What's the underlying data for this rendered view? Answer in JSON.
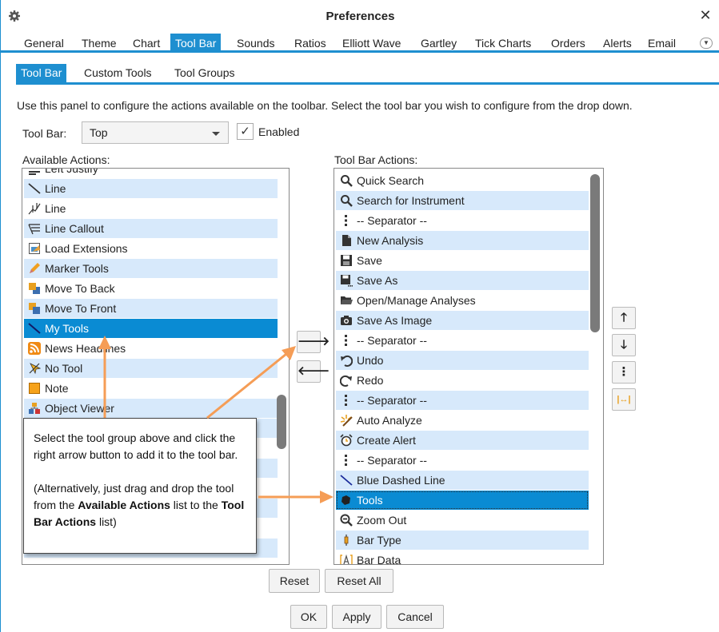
{
  "window": {
    "title": "Preferences",
    "close_symbol": "✕"
  },
  "tabs": [
    "General",
    "Theme",
    "Chart",
    "Tool Bar",
    "Sounds",
    "Ratios",
    "Elliott Wave",
    "Gartley",
    "Tick Charts",
    "Orders",
    "Alerts",
    "Email"
  ],
  "active_tab": "Tool Bar",
  "subtabs": [
    "Tool Bar",
    "Custom Tools",
    "Tool Groups"
  ],
  "active_subtab": "Tool Bar",
  "description": "Use this panel to configure the actions available on the toolbar.  Select the tool bar you wish to configure from the drop down.",
  "toolbar_select": {
    "label": "Tool Bar:",
    "value": "Top"
  },
  "enabled": {
    "label": "Enabled",
    "checked": true,
    "check_symbol": "✓"
  },
  "available": {
    "label": "Available Actions:",
    "items": [
      {
        "label": "Left Justify",
        "icon": "left-justify-icon"
      },
      {
        "label": "Line",
        "icon": "line-icon"
      },
      {
        "label": "Line",
        "icon": "line-tool-icon"
      },
      {
        "label": "Line Callout",
        "icon": "line-callout-icon"
      },
      {
        "label": "Load Extensions",
        "icon": "load-extensions-icon"
      },
      {
        "label": "Marker Tools",
        "icon": "marker-icon"
      },
      {
        "label": "Move To Back",
        "icon": "move-to-back-icon"
      },
      {
        "label": "Move To Front",
        "icon": "move-to-front-icon"
      },
      {
        "label": "My Tools",
        "icon": "my-tools-icon"
      },
      {
        "label": "News Headlines",
        "icon": "rss-icon"
      },
      {
        "label": "No Tool",
        "icon": "no-tool-icon"
      },
      {
        "label": "Note",
        "icon": "note-icon"
      },
      {
        "label": "Object Viewer",
        "icon": "object-viewer-icon"
      }
    ],
    "selected": "My Tools"
  },
  "toolbar_actions": {
    "label": "Tool Bar Actions:",
    "items": [
      {
        "label": "Quick Search",
        "icon": "search-icon"
      },
      {
        "label": "Search for Instrument",
        "icon": "search-icon"
      },
      {
        "label": "-- Separator --",
        "icon": "separator-icon"
      },
      {
        "label": "New Analysis",
        "icon": "document-icon"
      },
      {
        "label": "Save",
        "icon": "save-icon"
      },
      {
        "label": "Save As",
        "icon": "save-as-icon"
      },
      {
        "label": "Open/Manage Analyses",
        "icon": "folder-icon"
      },
      {
        "label": "Save As Image",
        "icon": "camera-icon"
      },
      {
        "label": "-- Separator --",
        "icon": "separator-icon"
      },
      {
        "label": "Undo",
        "icon": "undo-icon"
      },
      {
        "label": "Redo",
        "icon": "redo-icon"
      },
      {
        "label": "-- Separator --",
        "icon": "separator-icon"
      },
      {
        "label": "Auto Analyze",
        "icon": "auto-analyze-icon"
      },
      {
        "label": "Create Alert",
        "icon": "alarm-icon"
      },
      {
        "label": "-- Separator --",
        "icon": "separator-icon"
      },
      {
        "label": "Blue Dashed Line",
        "icon": "line-icon"
      },
      {
        "label": "Tools",
        "icon": "tools-icon"
      },
      {
        "label": "Zoom Out",
        "icon": "zoom-out-icon"
      },
      {
        "label": "Bar Type",
        "icon": "bar-type-icon"
      },
      {
        "label": "Bar Data",
        "icon": "bar-data-icon"
      }
    ],
    "selected": "Tools"
  },
  "move_buttons": {
    "add": "🡒",
    "remove": "🡐"
  },
  "order_buttons": {
    "up": "🡑",
    "down": "🡓",
    "separator": "⋮",
    "spacer": "|↔|"
  },
  "reset_label": "Reset",
  "reset_all_label": "Reset All",
  "ok_label": "OK",
  "apply_label": "Apply",
  "cancel_label": "Cancel",
  "callout": {
    "line1": "Select the tool group above and click the right arrow button to add it to the tool bar.",
    "line2_pre": "(Alternatively, just drag and drop the tool from the ",
    "line2_b1": "Available Actions",
    "line2_mid": " list to the ",
    "line2_b2": "Tool Bar Actions",
    "line2_post": " list)"
  },
  "colors": {
    "accent": "#1e8fd0",
    "selection": "#0a8bd3",
    "row_alt": "#d7e9fb",
    "arrow": "#f59d56"
  }
}
